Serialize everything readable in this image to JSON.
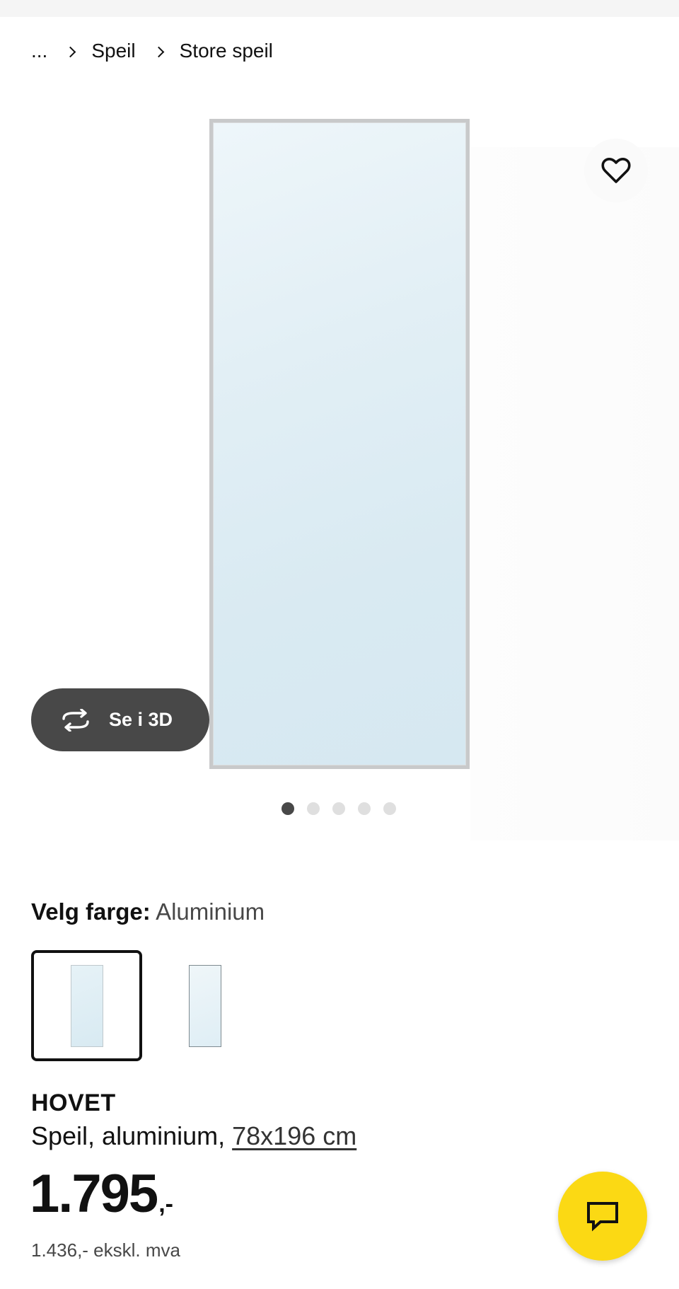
{
  "breadcrumb": {
    "items": [
      "...",
      "Speil",
      "Store speil"
    ]
  },
  "gallery": {
    "image_count": 5,
    "active_index": 0,
    "favorite_icon": "heart-icon",
    "view_3d_label": "Se i 3D",
    "view_3d_icon": "rotate-3d-icon"
  },
  "color_select": {
    "label": "Velg farge:",
    "value": "Aluminium",
    "options_count": 2,
    "selected_index": 0
  },
  "product": {
    "name": "HOVET",
    "description": "Speil, aluminium, ",
    "size": "78x196 cm"
  },
  "price": {
    "main": "1.795",
    "suffix": ",-",
    "ex_vat": "1.436,- ekskl. mva"
  },
  "chat": {
    "icon": "chat-icon",
    "color": "#fbd914"
  },
  "colors": {
    "accent_yellow": "#fbd914",
    "dark_button": "#484848"
  }
}
